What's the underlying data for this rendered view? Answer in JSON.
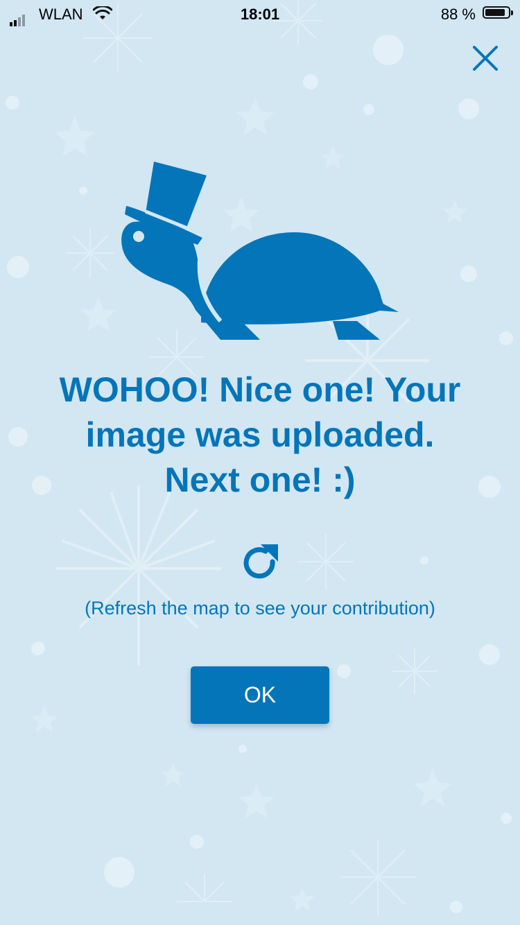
{
  "status_bar": {
    "carrier": "WLAN",
    "time": "18:01",
    "battery_percent": "88 %",
    "battery_level": 0.88,
    "signal_bars": 2
  },
  "dialog": {
    "headline_lines": [
      "WOHOO! Nice one! Your",
      "image was uploaded.",
      "Next one! :)"
    ],
    "hint": "(Refresh the map to see your contribution)",
    "ok_label": "OK"
  },
  "icons": {
    "close": "close-icon",
    "refresh": "refresh-icon",
    "mascot": "turtle-with-top-hat"
  },
  "colors": {
    "background": "#d2e7f2",
    "accent": "#0575ba",
    "button_text": "#ffffff"
  }
}
